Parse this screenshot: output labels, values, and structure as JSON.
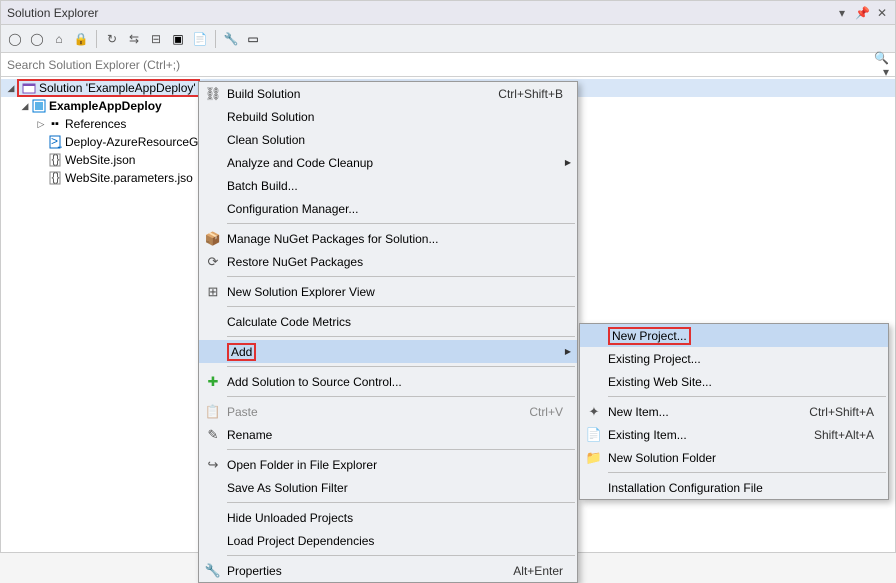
{
  "title": "Solution Explorer",
  "search_placeholder": "Search Solution Explorer (Ctrl+;)",
  "tree": {
    "solution": "Solution 'ExampleAppDeploy'",
    "project": "ExampleAppDeploy",
    "references": "References",
    "items": [
      "Deploy-AzureResourceG",
      "WebSite.json",
      "WebSite.parameters.jso"
    ]
  },
  "menu1": {
    "build": "Build Solution",
    "build_sc": "Ctrl+Shift+B",
    "rebuild": "Rebuild Solution",
    "clean": "Clean Solution",
    "analyze": "Analyze and Code Cleanup",
    "batch": "Batch Build...",
    "config": "Configuration Manager...",
    "nuget_manage": "Manage NuGet Packages for Solution...",
    "nuget_restore": "Restore NuGet Packages",
    "new_view": "New Solution Explorer View",
    "metrics": "Calculate Code Metrics",
    "add": "Add",
    "source_ctrl": "Add Solution to Source Control...",
    "paste": "Paste",
    "paste_sc": "Ctrl+V",
    "rename": "Rename",
    "open_folder": "Open Folder in File Explorer",
    "save_filter": "Save As Solution Filter",
    "hide_unloaded": "Hide Unloaded Projects",
    "load_deps": "Load Project Dependencies",
    "properties": "Properties",
    "properties_sc": "Alt+Enter"
  },
  "menu2": {
    "new_project": "New Project...",
    "existing_project": "Existing Project...",
    "existing_web": "Existing Web Site...",
    "new_item": "New Item...",
    "new_item_sc": "Ctrl+Shift+A",
    "existing_item": "Existing Item...",
    "existing_item_sc": "Shift+Alt+A",
    "new_folder": "New Solution Folder",
    "install_config": "Installation Configuration File"
  }
}
